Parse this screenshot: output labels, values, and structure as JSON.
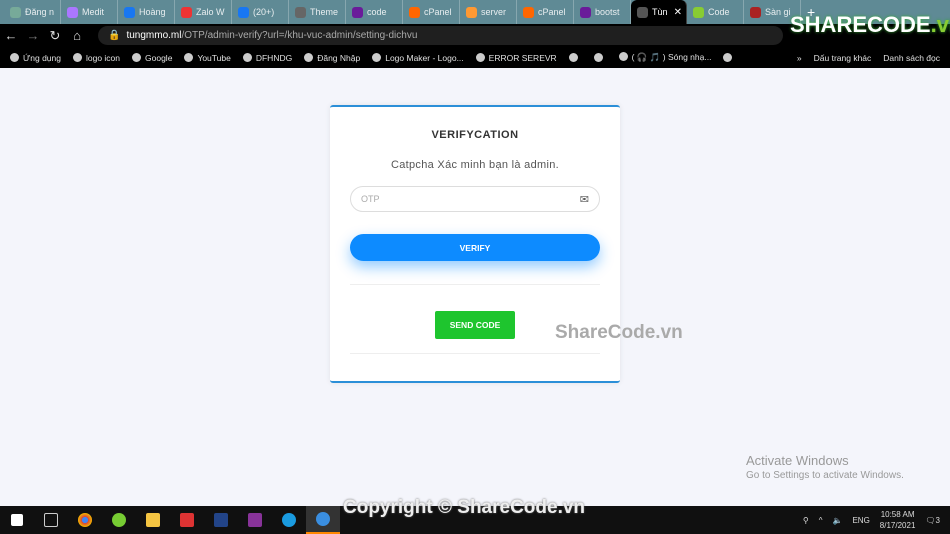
{
  "browser": {
    "tabs": [
      {
        "label": "Đăng n",
        "color": "#7a9"
      },
      {
        "label": "Medit",
        "color": "#a7f"
      },
      {
        "label": "Hoàng",
        "color": "#1877f2"
      },
      {
        "label": "Zalo W",
        "color": "#e33"
      },
      {
        "label": "(20+)",
        "color": "#1877f2"
      },
      {
        "label": "Theme",
        "color": "#666"
      },
      {
        "label": "code",
        "color": "#6a1b9a"
      },
      {
        "label": "cPanel",
        "color": "#f60"
      },
      {
        "label": "server",
        "color": "#f93"
      },
      {
        "label": "cPanel",
        "color": "#f60"
      },
      {
        "label": "bootst",
        "color": "#6a1b9a"
      },
      {
        "label": "Tùn",
        "color": "#555",
        "active": true
      },
      {
        "label": "Code",
        "color": "#8c3"
      },
      {
        "label": "Sàn gi",
        "color": "#a22"
      }
    ],
    "url_host": "tungmmo.ml",
    "url_path": "/OTP/admin-verify?url=/khu-vuc-admin/setting-dichvu",
    "bookmarks": [
      "Ứng dụng",
      "logo icon",
      "Google",
      "YouTube",
      "DFHNDG",
      "Đăng Nhập",
      "Logo Maker - Logo...",
      "ERROR SEREVR",
      "",
      "",
      "( 🎧 🎵 ) Sóng nhạ...",
      ""
    ],
    "bookmarks_more": "»",
    "other_bookmarks": "Dấu trang khác",
    "reading_list": "Danh sách đọc"
  },
  "card": {
    "title": "VERIFYCATION",
    "subtitle": "Catpcha Xác minh bạn là admin.",
    "otp_placeholder": "OTP",
    "otp_value": "",
    "verify_label": "VERIFY",
    "send_label": "SEND CODE",
    "accent": "#0d8bff",
    "send_color": "#1ec52e"
  },
  "watermark": {
    "center": "ShareCode.vn",
    "copyright": "Copyright © ShareCode.vn",
    "logo": "SHARECODE",
    "logo_suffix": ".vn"
  },
  "activate": {
    "title": "Activate Windows",
    "sub": "Go to Settings to activate Windows."
  },
  "taskbar": {
    "lang": "ENG",
    "time": "10:58 AM",
    "date": "8/17/2021",
    "notifications": "3"
  }
}
